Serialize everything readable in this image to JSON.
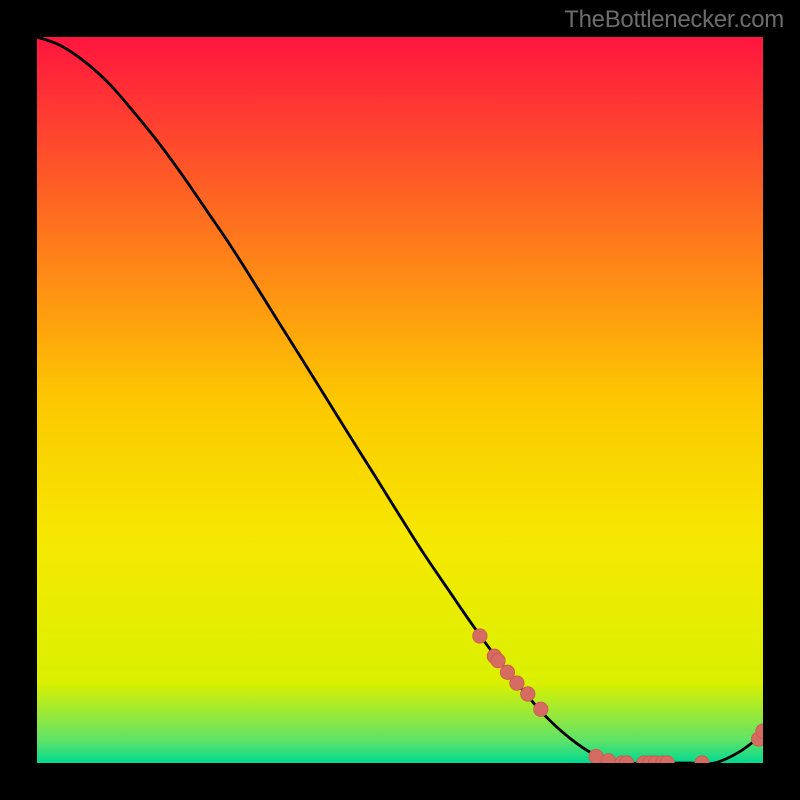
{
  "watermark": "TheBottlenecker.com",
  "chart_data": {
    "type": "line",
    "title": "",
    "xlabel": "",
    "ylabel": "",
    "x": [
      0.0,
      0.033,
      0.067,
      0.1,
      0.133,
      0.167,
      0.2,
      0.233,
      0.267,
      0.3,
      0.333,
      0.367,
      0.4,
      0.433,
      0.467,
      0.5,
      0.533,
      0.567,
      0.6,
      0.633,
      0.667,
      0.7,
      0.733,
      0.767,
      0.8,
      0.833,
      0.867,
      0.9,
      0.933,
      0.967,
      1.0
    ],
    "series": [
      {
        "name": "bottleneck-curve",
        "y": [
          1.0,
          0.988,
          0.965,
          0.935,
          0.897,
          0.855,
          0.81,
          0.762,
          0.712,
          0.66,
          0.607,
          0.553,
          0.5,
          0.447,
          0.393,
          0.34,
          0.288,
          0.238,
          0.19,
          0.145,
          0.103,
          0.065,
          0.035,
          0.012,
          0.0,
          0.0,
          0.0,
          0.0,
          0.0,
          0.015,
          0.04
        ]
      }
    ],
    "markers": {
      "name": "highlight-points",
      "points": [
        {
          "x": 0.61,
          "y": 0.175
        },
        {
          "x": 0.63,
          "y": 0.147
        },
        {
          "x": 0.635,
          "y": 0.141
        },
        {
          "x": 0.648,
          "y": 0.125
        },
        {
          "x": 0.661,
          "y": 0.11
        },
        {
          "x": 0.676,
          "y": 0.095
        },
        {
          "x": 0.694,
          "y": 0.074
        },
        {
          "x": 0.77,
          "y": 0.009
        },
        {
          "x": 0.787,
          "y": 0.003
        },
        {
          "x": 0.806,
          "y": 0.0
        },
        {
          "x": 0.812,
          "y": 0.0
        },
        {
          "x": 0.836,
          "y": 0.0
        },
        {
          "x": 0.844,
          "y": 0.0
        },
        {
          "x": 0.852,
          "y": 0.0
        },
        {
          "x": 0.862,
          "y": 0.0
        },
        {
          "x": 0.868,
          "y": 0.0
        },
        {
          "x": 0.916,
          "y": 0.0
        },
        {
          "x": 0.994,
          "y": 0.033
        },
        {
          "x": 1.0,
          "y": 0.044
        }
      ]
    },
    "background": {
      "type": "vertical-gradient",
      "stops": [
        {
          "pos": 0.0,
          "color": "#ff153f"
        },
        {
          "pos": 0.5,
          "color": "#fdc800"
        },
        {
          "pos": 0.7,
          "color": "#f5e900"
        },
        {
          "pos": 0.89,
          "color": "#daf000"
        },
        {
          "pos": 0.97,
          "color": "#5de36a"
        },
        {
          "pos": 1.0,
          "color": "#00d890"
        }
      ]
    },
    "ylim": [
      0,
      1
    ],
    "xlim": [
      0,
      1
    ],
    "colors": {
      "line": "#000000",
      "marker_fill": "#d66b61",
      "marker_stroke": "#c95a50"
    }
  }
}
